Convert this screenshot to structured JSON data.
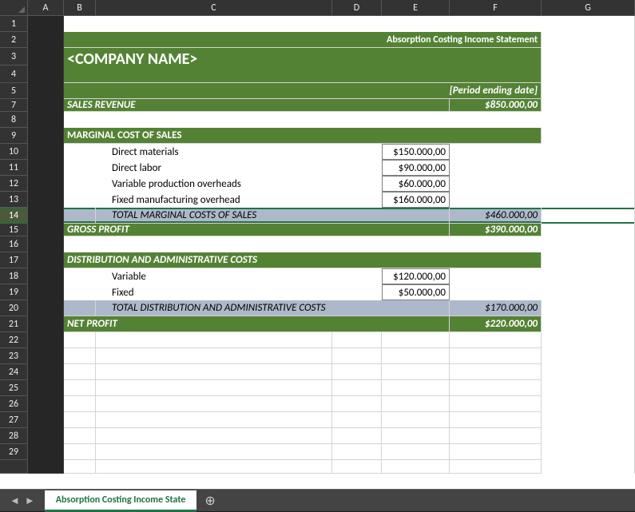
{
  "columns": [
    "A",
    "B",
    "C",
    "D",
    "E",
    "F",
    "G"
  ],
  "rows": [
    "1",
    "2",
    "3",
    "4",
    "5",
    "7",
    "8",
    "9",
    "10",
    "11",
    "12",
    "13",
    "14",
    "15",
    "16",
    "17",
    "18",
    "19",
    "20",
    "21",
    "22",
    "23",
    "24",
    "25",
    "26",
    "27",
    "28",
    "29",
    ""
  ],
  "selected_row_index": 12,
  "header": {
    "title_right": "Absorption Costing Income Statement",
    "company": "<COMPANY NAME>",
    "period": "[Period ending date]"
  },
  "sales": {
    "label": "SALES REVENUE",
    "value": "$850.000,00"
  },
  "marginal": {
    "section": "MARGINAL COST OF SALES",
    "items": [
      {
        "label": "Direct materials",
        "value": "$150.000,00"
      },
      {
        "label": "Direct labor",
        "value": "$90.000,00"
      },
      {
        "label": "Variable production overheads",
        "value": "$60.000,00"
      },
      {
        "label": "Fixed manufacturing overhead",
        "value": "$160.000,00"
      }
    ],
    "total_label": "TOTAL MARGINAL COSTS OF SALES",
    "total_value": "$460.000,00"
  },
  "gross_profit": {
    "label": "GROSS PROFIT",
    "value": "$390.000,00"
  },
  "dist": {
    "section": "DISTRIBUTION AND ADMINISTRATIVE  COSTS",
    "items": [
      {
        "label": "Variable",
        "value": "$120.000,00"
      },
      {
        "label": "Fixed",
        "value": "$50.000,00"
      }
    ],
    "total_label": "TOTAL DISTRIBUTION AND ADMINISTRATIVE  COSTS",
    "total_value": "$170.000,00"
  },
  "net_profit": {
    "label": "NET PROFIT",
    "value": "$220.000,00"
  },
  "tabs": {
    "active": "Absorption Costing Income State"
  }
}
